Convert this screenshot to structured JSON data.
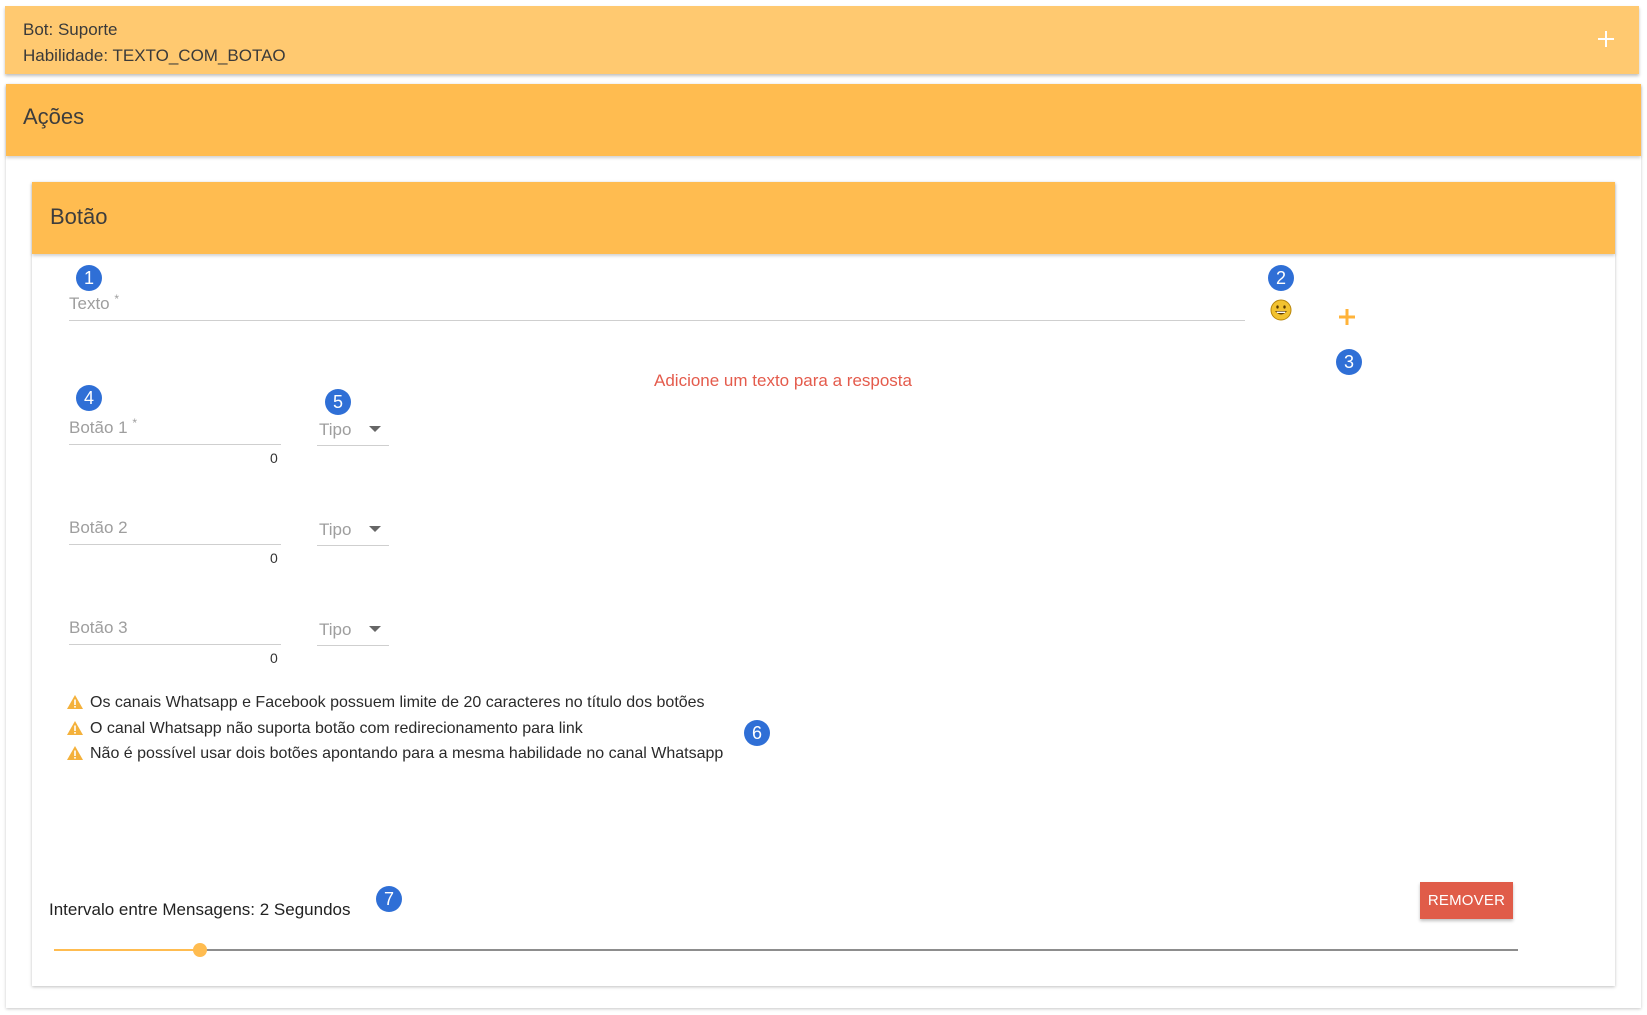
{
  "topbar": {
    "bot_label": "Bot: Suporte",
    "skill_label": "Habilidade: TEXTO_COM_BOTAO"
  },
  "acoes": {
    "title": "Ações"
  },
  "card": {
    "title": "Botão",
    "badges": [
      "1",
      "2",
      "3",
      "4",
      "5",
      "6",
      "7"
    ],
    "text_field": {
      "label": "Texto",
      "required_mark": "*"
    },
    "error": "Adicione um texto para a resposta",
    "buttons": [
      {
        "label": "Botão 1",
        "required_mark": "*",
        "counter": "0",
        "type_label": "Tipo"
      },
      {
        "label": "Botão 2",
        "required_mark": "",
        "counter": "0",
        "type_label": "Tipo"
      },
      {
        "label": "Botão 3",
        "required_mark": "",
        "counter": "0",
        "type_label": "Tipo"
      }
    ],
    "warnings": [
      "Os canais Whatsapp e Facebook possuem limite de 20 caracteres no título dos botões",
      "O canal Whatsapp não suporta botão com redirecionamento para link",
      "Não é possível usar dois botões apontando para a mesma habilidade no canal Whatsapp"
    ],
    "interval_label": "Intervalo entre Mensagens: 2 Segundos",
    "slider_value_fraction": 0.1,
    "remove_label": "REMOVER"
  },
  "icons": {
    "topbar_add": "plus-icon",
    "emoji": "emoji-smile-icon",
    "add_button": "plus-icon",
    "warning": "warning-triangle-icon"
  },
  "colors": {
    "topbar": "#ffc970",
    "header": "#ffbc50",
    "accent": "#ffbc50",
    "error": "#e45b4c",
    "badge": "#2f6fd6",
    "remove": "#e05c49"
  }
}
